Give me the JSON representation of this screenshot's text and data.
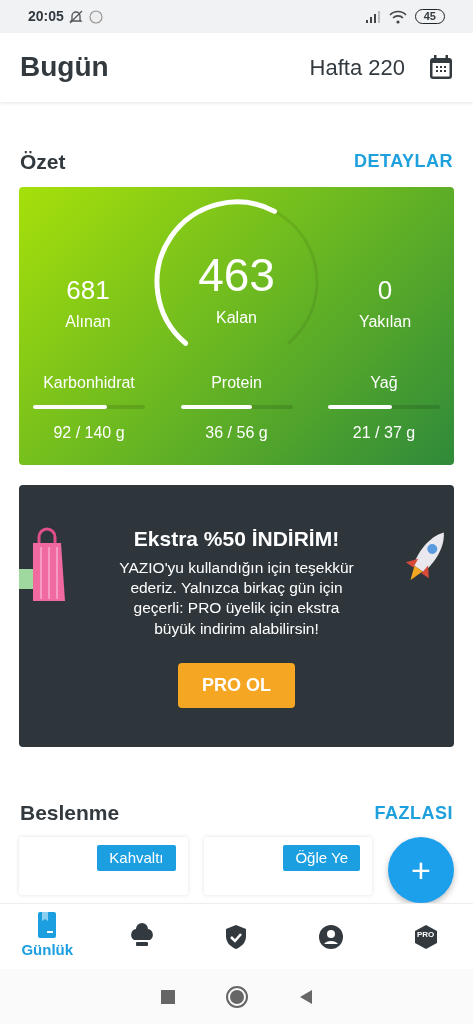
{
  "status_bar": {
    "time": "20:05",
    "battery": "45"
  },
  "header": {
    "title": "Bugün",
    "week": "Hafta 220"
  },
  "summary": {
    "title": "Özet",
    "link": "DETAYLAR",
    "eaten": {
      "value": "681",
      "label": "Alınan"
    },
    "remaining": {
      "value": "463",
      "label": "Kalan"
    },
    "burned": {
      "value": "0",
      "label": "Yakılan"
    },
    "macros": [
      {
        "name": "Karbonhidrat",
        "amount": "92 / 140 g",
        "level": 0.66
      },
      {
        "name": "Protein",
        "amount": "36 / 56 g",
        "level": 0.64
      },
      {
        "name": "Yağ",
        "amount": "21 / 37 g",
        "level": 0.57
      }
    ]
  },
  "promo": {
    "title": "Ekstra %50 İNDİRİM!",
    "text": "YAZIO'yu kullandığın için teşekkür ederiz. Yalnızca birkaç gün için geçerli: PRO üyelik için ekstra büyük indirim alabilirsin!",
    "button": "PRO OL"
  },
  "nutrition": {
    "title": "Beslenme",
    "link": "FAZLASI",
    "meals": [
      {
        "label": "Kahvaltı"
      },
      {
        "label": "Öğle Ye"
      }
    ]
  },
  "fab": {
    "label": "+"
  },
  "bottom_nav": [
    {
      "kind": "diary",
      "label": "Günlük",
      "selected": true
    },
    {
      "kind": "recipes",
      "selected": false
    },
    {
      "kind": "shield",
      "selected": false
    },
    {
      "kind": "profile",
      "selected": false
    },
    {
      "kind": "pro",
      "badge": "PRO",
      "selected": false
    }
  ]
}
